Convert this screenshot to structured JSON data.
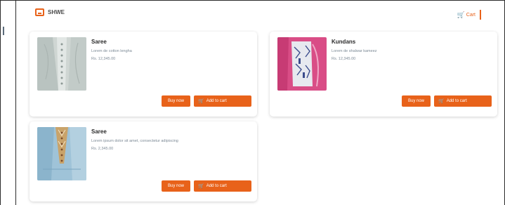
{
  "brand": {
    "name": "SHWE",
    "icon": "shop-logo-icon",
    "accent": "#e8621a"
  },
  "header": {
    "cart_label": "Cart",
    "cart_icon": "cart-icon"
  },
  "products": [
    {
      "name": "Saree",
      "description": "Lorem de cotton lengha",
      "price": "Rs. 12,345.00",
      "buy_label": "Buy now",
      "cart_label": "Add to cart",
      "cart_icon": "cart-icon"
    },
    {
      "name": "Kundans",
      "description": "Lorem de shalwar kameez",
      "price": "Rs. 12,345.00",
      "buy_label": "Buy now",
      "cart_label": "Add to cart",
      "cart_icon": "cart-icon"
    },
    {
      "name": "Saree",
      "description": "Lorem ipsum dolor sit amet, consectetur adipiscing",
      "price": "Rs. 2,345.00",
      "buy_label": "Buy now",
      "cart_label": "Add to cart",
      "cart_icon": "cart-icon"
    }
  ]
}
